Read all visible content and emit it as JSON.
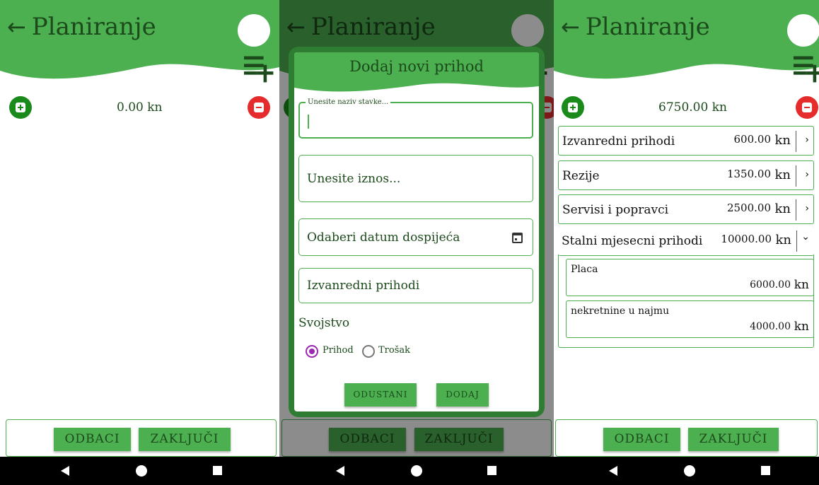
{
  "colors": {
    "header_green": "#4caf50",
    "dialog_green": "#2e7d32",
    "add_green": "#1a8a1a",
    "remove_red": "#e52b2b",
    "radio_purple": "#9c27b0"
  },
  "screen1": {
    "title": "Planiranje",
    "back_icon": "←",
    "amount": "0.00 kn",
    "buttons": {
      "discard": "ODBACI",
      "finish": "ZAKLJUČI"
    }
  },
  "screen2": {
    "title": "Planiranje",
    "back_icon": "←",
    "background_buttons": {
      "discard": "ODBACI",
      "finish": "ZAKLJUČI"
    },
    "dialog": {
      "title": "Dodaj novi prihod",
      "name_label": "Unesite naziv stavke...",
      "name_value": "",
      "amount_placeholder": "Unesite iznos...",
      "date_placeholder": "Odaberi datum dospijeća",
      "category_value": "Izvanredni prihodi",
      "property_label": "Svojstvo",
      "radio_income": "Prihod",
      "radio_expense": "Trošak",
      "selected_radio": "Prihod",
      "cancel": "ODUSTANI",
      "add": "DODAJ"
    }
  },
  "screen3": {
    "title": "Planiranje",
    "back_icon": "←",
    "amount": "6750.00 kn",
    "rows": [
      {
        "name": "Izvanredni prihodi",
        "value": "600.00",
        "unit": "kn",
        "chevron": "›"
      },
      {
        "name": "Rezije",
        "value": "1350.00",
        "unit": "kn",
        "chevron": "›"
      },
      {
        "name": "Servisi i popravci",
        "value": "2500.00",
        "unit": "kn",
        "chevron": "›"
      },
      {
        "name": "Stalni mjesecni prihodi",
        "value": "10000.00",
        "unit": "kn",
        "chevron": "⌄"
      }
    ],
    "sub_items": [
      {
        "name": "Placa",
        "value": "6000.00",
        "unit": "kn"
      },
      {
        "name": "nekretnine u najmu",
        "value": "4000.00",
        "unit": "kn"
      }
    ],
    "buttons": {
      "discard": "ODBACI",
      "finish": "ZAKLJUČI"
    }
  }
}
